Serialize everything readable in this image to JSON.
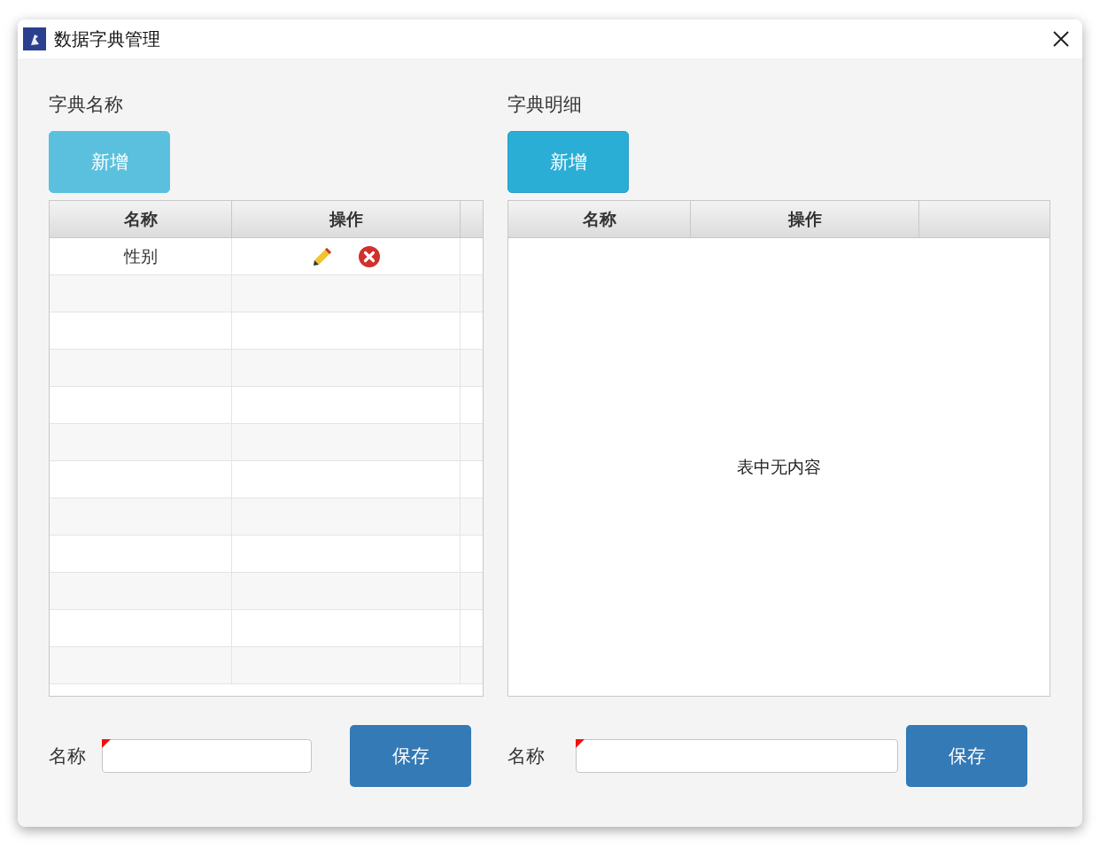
{
  "window": {
    "title": "数据字典管理"
  },
  "panels": [
    {
      "title": "字典名称",
      "add_button": {
        "label": "新增",
        "highlighted": true
      },
      "columns": [
        "名称",
        "操作"
      ],
      "rows": [
        {
          "name": "性别"
        }
      ],
      "form": {
        "label": "名称",
        "required": true,
        "save_label": "保存"
      }
    },
    {
      "title": "字典明细",
      "add_button": {
        "label": "新增",
        "highlighted": false
      },
      "columns": [
        "名称",
        "操作"
      ],
      "empty_text": "表中无内容",
      "form": {
        "label": "名称",
        "required": true,
        "save_label": "保存"
      }
    }
  ]
}
